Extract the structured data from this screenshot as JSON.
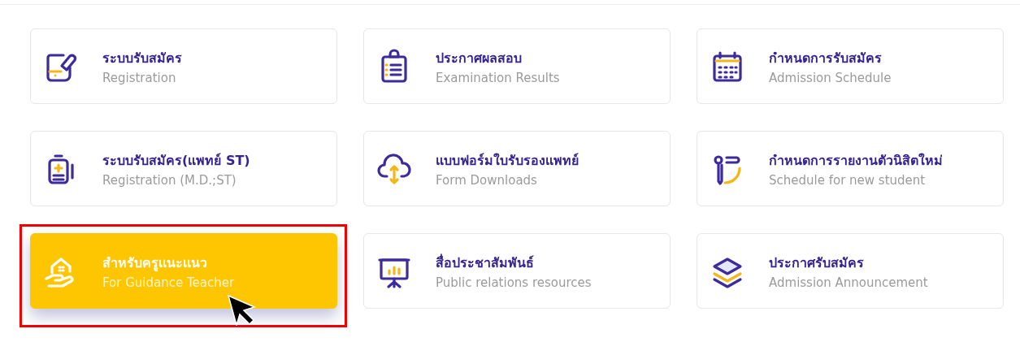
{
  "menu_cards": [
    {
      "title": "ระบบรับสมัคร",
      "subtitle": "Registration",
      "selected": false
    },
    {
      "title": "ประกาศผลสอบ",
      "subtitle": "Examination Results",
      "selected": false
    },
    {
      "title": "กำหนดการรับสมัคร",
      "subtitle": "Admission Schedule",
      "selected": false
    },
    {
      "title": "ระบบรับสมัคร(แพทย์ ST)",
      "subtitle": "Registration (M.D.;ST)",
      "selected": false
    },
    {
      "title": "แบบฟอร์มใบรับรองแพทย์",
      "subtitle": "Form Downloads",
      "selected": false
    },
    {
      "title": "กำหนดการรายงานตัวนิสิตใหม่",
      "subtitle": "Schedule for new student",
      "selected": false
    },
    {
      "title": "สำหรับครูแนะแนว",
      "subtitle": "For Guidance Teacher",
      "selected": true
    },
    {
      "title": "สื่อประชาสัมพันธ์",
      "subtitle": "Public relations resources",
      "selected": false
    },
    {
      "title": "ประกาศรับสมัคร",
      "subtitle": "Admission Announcement",
      "selected": false
    }
  ]
}
